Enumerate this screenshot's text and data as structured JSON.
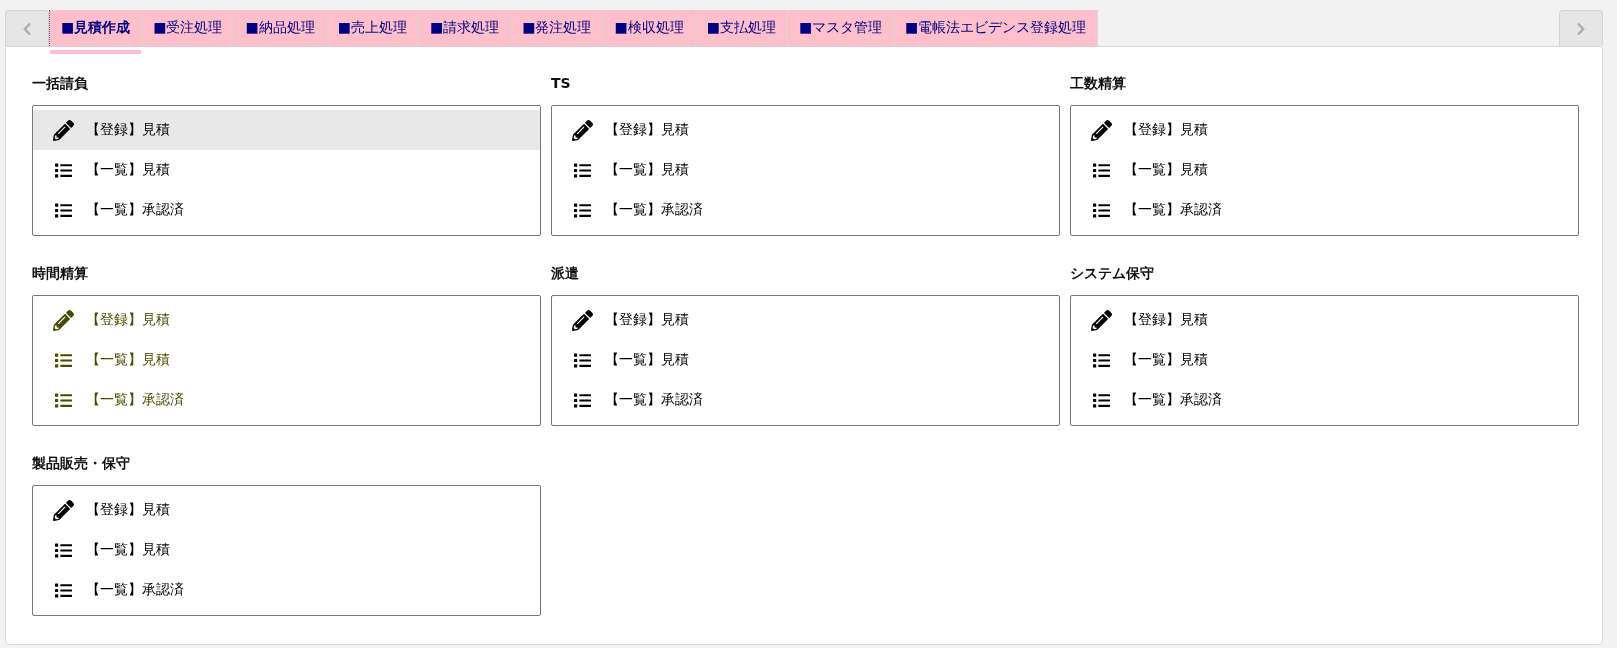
{
  "tab_bar": {
    "tabs": [
      {
        "label": "■見積作成",
        "selected": true
      },
      {
        "label": "■受注処理",
        "selected": false
      },
      {
        "label": "■納品処理",
        "selected": false
      },
      {
        "label": "■売上処理",
        "selected": false
      },
      {
        "label": "■請求処理",
        "selected": false
      },
      {
        "label": "■発注処理",
        "selected": false
      },
      {
        "label": "■検収処理",
        "selected": false
      },
      {
        "label": "■支払処理",
        "selected": false
      },
      {
        "label": "■マスタ管理",
        "selected": false
      },
      {
        "label": "■電帳法エビデンス登録処理",
        "selected": false
      }
    ]
  },
  "sections": [
    {
      "title": "一括請負",
      "color": "#000000",
      "items": [
        {
          "kind": "edit",
          "label": "【登録】見積",
          "selected": true
        },
        {
          "kind": "list",
          "label": "【一覧】見積",
          "selected": false
        },
        {
          "kind": "list",
          "label": "【一覧】承認済",
          "selected": false
        }
      ]
    },
    {
      "title": "TS",
      "color": "#000000",
      "items": [
        {
          "kind": "edit",
          "label": "【登録】見積",
          "selected": false
        },
        {
          "kind": "list",
          "label": "【一覧】見積",
          "selected": false
        },
        {
          "kind": "list",
          "label": "【一覧】承認済",
          "selected": false
        }
      ]
    },
    {
      "title": "工数精算",
      "color": "#000000",
      "items": [
        {
          "kind": "edit",
          "label": "【登録】見積",
          "selected": false
        },
        {
          "kind": "list",
          "label": "【一覧】見積",
          "selected": false
        },
        {
          "kind": "list",
          "label": "【一覧】承認済",
          "selected": false
        }
      ]
    },
    {
      "title": "時間精算",
      "color": "#4b4b00",
      "items": [
        {
          "kind": "edit",
          "label": "【登録】見積",
          "selected": false
        },
        {
          "kind": "list",
          "label": "【一覧】見積",
          "selected": false
        },
        {
          "kind": "list",
          "label": "【一覧】承認済",
          "selected": false
        }
      ]
    },
    {
      "title": "派遣",
      "color": "#000000",
      "items": [
        {
          "kind": "edit",
          "label": "【登録】見積",
          "selected": false
        },
        {
          "kind": "list",
          "label": "【一覧】見積",
          "selected": false
        },
        {
          "kind": "list",
          "label": "【一覧】承認済",
          "selected": false
        }
      ]
    },
    {
      "title": "システム保守",
      "color": "#000000",
      "items": [
        {
          "kind": "edit",
          "label": "【登録】見積",
          "selected": false
        },
        {
          "kind": "list",
          "label": "【一覧】見積",
          "selected": false
        },
        {
          "kind": "list",
          "label": "【一覧】承認済",
          "selected": false
        }
      ]
    },
    {
      "title": "製品販売・保守",
      "color": "#000000",
      "items": [
        {
          "kind": "edit",
          "label": "【登録】見積",
          "selected": false
        },
        {
          "kind": "list",
          "label": "【一覧】見積",
          "selected": false
        },
        {
          "kind": "list",
          "label": "【一覧】承認済",
          "selected": false
        }
      ]
    }
  ]
}
